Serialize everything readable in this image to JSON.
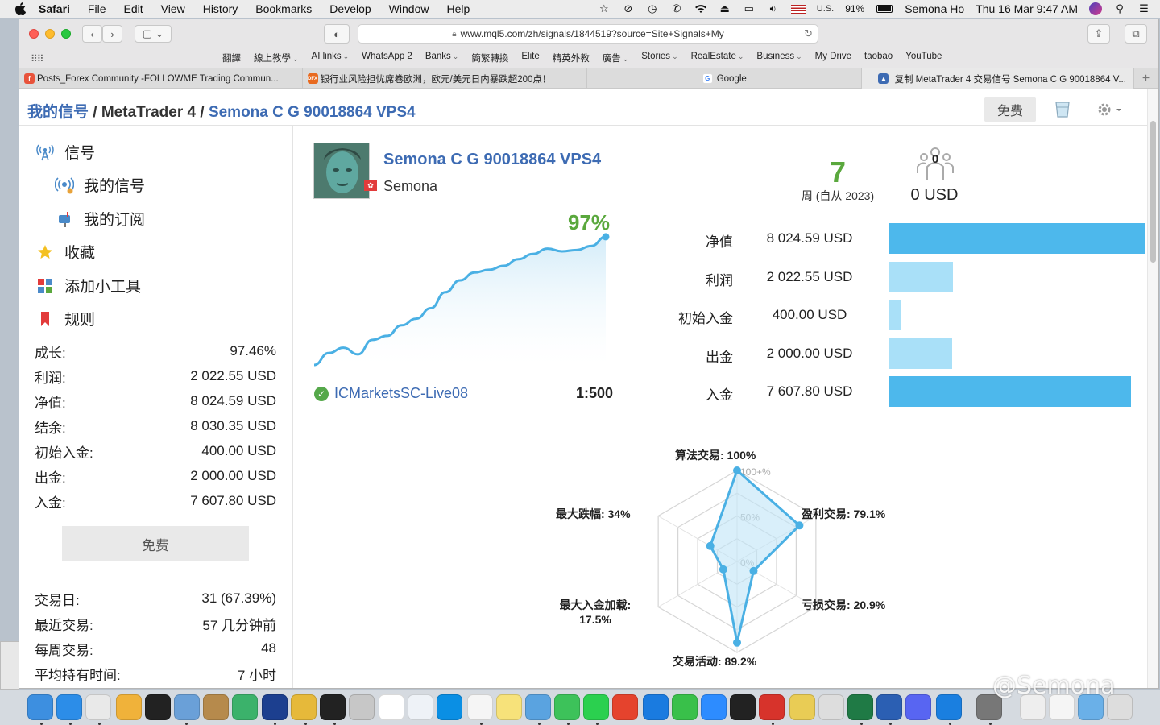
{
  "menubar": {
    "app": "Safari",
    "items": [
      "File",
      "Edit",
      "View",
      "History",
      "Bookmarks",
      "Develop",
      "Window",
      "Help"
    ],
    "input_source": "U.S.",
    "battery": "91%",
    "user": "Semona Ho",
    "clock": "Thu 16 Mar  9:47 AM"
  },
  "browser": {
    "url": "www.mql5.com/zh/signals/1844519?source=Site+Signals+My",
    "bookmarks": [
      {
        "label": "翻譯",
        "menu": false
      },
      {
        "label": "線上教學",
        "menu": true
      },
      {
        "label": "AI links",
        "menu": true
      },
      {
        "label": "WhatsApp 2",
        "menu": false
      },
      {
        "label": "Banks",
        "menu": true
      },
      {
        "label": "簡繁轉換",
        "menu": false
      },
      {
        "label": "Elite",
        "menu": false
      },
      {
        "label": "精英外教",
        "menu": false
      },
      {
        "label": "廣告",
        "menu": true
      },
      {
        "label": "Stories",
        "menu": true
      },
      {
        "label": "RealEstate",
        "menu": true
      },
      {
        "label": "Business",
        "menu": true
      },
      {
        "label": "My Drive",
        "menu": false
      },
      {
        "label": "taobao",
        "menu": false
      },
      {
        "label": "YouTube",
        "menu": false
      }
    ],
    "tabs": [
      {
        "title": "Posts_Forex Community -FOLLOWME Trading Commun...",
        "favicon": "followme-icon",
        "color": "#e8533b",
        "active": false
      },
      {
        "title": "银行业风险担忧席卷欧洲，欧元/美元日内暴跌超200点！",
        "favicon": "dfx-icon",
        "color": "#e86a1f",
        "active": false
      },
      {
        "title": "Google",
        "favicon": "google-icon",
        "color": "#4285f4",
        "active": false
      },
      {
        "title": "复制 MetaTrader 4 交易信号 Semona C G 90018864 V...",
        "favicon": "mql5-icon",
        "color": "#3d6bb3",
        "active": true
      }
    ]
  },
  "header": {
    "crumb_1": "我的信号",
    "crumb_2": "MetaTrader 4",
    "crumb_3": "Semona C G 90018864 VPS4",
    "free_button": "免费"
  },
  "sidebar": {
    "nav": [
      {
        "label": "信号",
        "icon": "antenna-icon",
        "indent": false
      },
      {
        "label": "我的信号",
        "icon": "broadcast-icon",
        "indent": true
      },
      {
        "label": "我的订阅",
        "icon": "mailbox-icon",
        "indent": true
      },
      {
        "label": "收藏",
        "icon": "star-icon",
        "indent": false
      },
      {
        "label": "添加小工具",
        "icon": "widgets-icon",
        "indent": false
      },
      {
        "label": "规则",
        "icon": "bookmark-icon",
        "indent": false
      }
    ],
    "stats": [
      {
        "label": "成长:",
        "value": "97.46%"
      },
      {
        "label": "利润:",
        "value": "2 022.55 USD"
      },
      {
        "label": "净值:",
        "value": "8 024.59 USD"
      },
      {
        "label": "结余:",
        "value": "8 030.35 USD"
      },
      {
        "label": "初始入金:",
        "value": "400.00 USD"
      },
      {
        "label": "出金:",
        "value": "2 000.00 USD"
      },
      {
        "label": "入金:",
        "value": "7 607.80 USD"
      }
    ],
    "free_button": "免费",
    "stats2": [
      {
        "label": "交易日:",
        "value": "31 (67.39%)"
      },
      {
        "label": "最近交易:",
        "value": "57 几分钟前"
      },
      {
        "label": "每周交易:",
        "value": "48"
      },
      {
        "label": "平均持有时间:",
        "value": "7 小时"
      }
    ]
  },
  "signal": {
    "title": "Semona C G 90018864 VPS4",
    "author": "Semona",
    "weeks": "7",
    "weeks_label": "周 (自从 2023)",
    "subscribers": "0",
    "price": "0 USD",
    "growth": "97%",
    "broker": "ICMarketsSC-Live08",
    "leverage": "1:500"
  },
  "balances": [
    {
      "label": "净值",
      "value": "8 024.59 USD",
      "amount": 8024.59,
      "color": "#4db8ec"
    },
    {
      "label": "利润",
      "value": "2 022.55 USD",
      "amount": 2022.55,
      "color": "#a9e0f8"
    },
    {
      "label": "初始入金",
      "value": "400.00 USD",
      "amount": 400.0,
      "color": "#a9e0f8"
    },
    {
      "label": "出金",
      "value": "2 000.00 USD",
      "amount": 2000.0,
      "color": "#a9e0f8"
    },
    {
      "label": "入金",
      "value": "7 607.80 USD",
      "amount": 7607.8,
      "color": "#4db8ec"
    }
  ],
  "chart_data": [
    {
      "type": "line",
      "ylabel": "",
      "x": [
        0,
        5,
        10,
        15,
        20,
        25,
        30,
        35,
        40,
        45,
        50,
        55,
        60,
        65,
        70,
        75,
        80,
        85,
        90,
        95,
        100
      ],
      "values": [
        0,
        9,
        13,
        8,
        19,
        22,
        30,
        35,
        43,
        55,
        64,
        70,
        72,
        75,
        80,
        84,
        88,
        86,
        87,
        90,
        97
      ],
      "ylim": [
        0,
        100
      ],
      "end_label": "97%",
      "color": "#4ab0e4"
    },
    {
      "type": "radar",
      "axes": [
        "算法交易: 100%",
        "盈利交易: 79.1%",
        "亏损交易: 20.9%",
        "交易活动: 89.2%",
        "最大入金加载: 17.5%",
        "最大跌幅: 34%"
      ],
      "values": [
        100,
        79.1,
        20.9,
        89.2,
        17.5,
        34
      ],
      "rings": [
        "100+%",
        "50%",
        "0%"
      ],
      "color": "#4ab0e4"
    }
  ],
  "dock": {
    "watermark": "@Semona",
    "apps": [
      "finder",
      "safari",
      "chrome",
      "photos",
      "activity-monitor",
      "preview",
      "notes-book",
      "adguard",
      "bitdefender",
      "norton",
      "scrivener",
      "calculator",
      "calendar",
      "mail",
      "skype",
      "textedit",
      "stickies",
      "tweetbot",
      "wechat",
      "whatsapp",
      "pdf-tool",
      "testflight",
      "facetime",
      "zoom",
      "quicktime",
      "acrobat",
      "zip",
      "screenshot",
      "excel",
      "word",
      "discord",
      "teamviewer",
      "system-preferences",
      "documents",
      "files",
      "downloads",
      "trash"
    ]
  }
}
